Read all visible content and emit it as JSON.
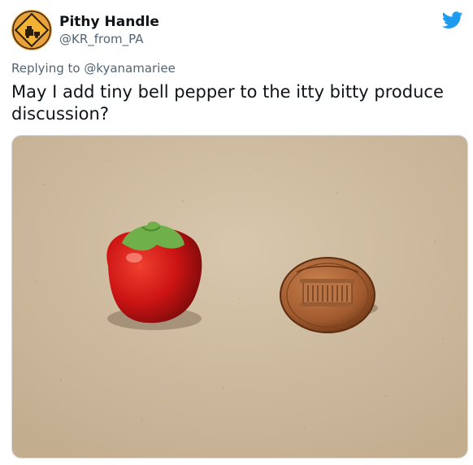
{
  "author": {
    "display_name": "Pithy Handle",
    "handle": "@KR_from_PA",
    "avatar_icon": "road-sign-avatar-icon"
  },
  "header": {
    "brand_icon": "twitter-bird-icon",
    "brand_color": "#1d9bf0"
  },
  "reply_context": {
    "text": "Replying to @kyanamariee"
  },
  "tweet": {
    "text": "May I add tiny bell pepper to the itty bitty produce discussion?"
  },
  "media": {
    "description_icon": "photo-tiny-bell-pepper-and-penny"
  },
  "colors": {
    "secondary_text": "#536471",
    "primary_text": "#0f1419",
    "background": "#ffffff"
  }
}
